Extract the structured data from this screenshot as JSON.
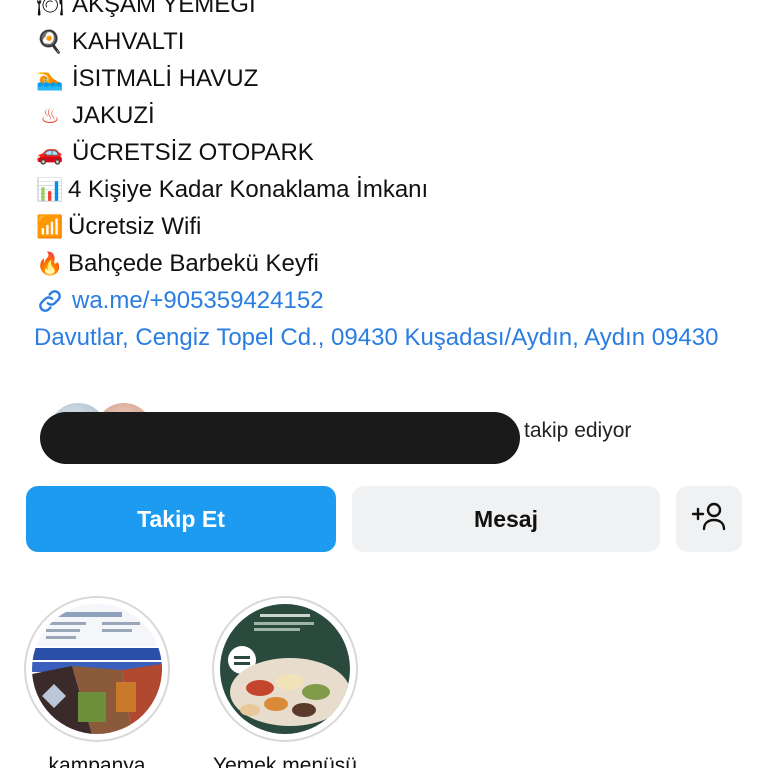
{
  "bio": {
    "lines": [
      {
        "icon": "plate-icon",
        "glyph": "🍽",
        "text": "AKŞAM YEMEĞİ"
      },
      {
        "icon": "frying-pan-icon",
        "glyph": "🍳",
        "text": "KAHVALTI"
      },
      {
        "icon": "swimmer-icon",
        "glyph": "🏊",
        "text": "İSITMALİ HAVUZ"
      },
      {
        "icon": "hot-springs-icon",
        "glyph": "♨",
        "text": "JAKUZİ"
      },
      {
        "icon": "car-icon",
        "glyph": "🚗",
        "text": "ÜCRETSİZ OTOPARK"
      },
      {
        "icon": "bar-chart-icon",
        "glyph": "📊",
        "text": "4 Kişiye Kadar Konaklama İmkanı"
      },
      {
        "icon": "signal-icon",
        "glyph": "📶",
        "text": "Ücretsiz Wifi"
      },
      {
        "icon": "fire-icon",
        "glyph": "🔥",
        "text": "Bahçede Barbekü Keyfi"
      }
    ],
    "link": "wa.me/+905359424152",
    "address": "Davutlar, Cengiz Topel Cd., 09430 Kuşadası/Aydın, Aydın 09430"
  },
  "followers": {
    "text": "takip ediyor"
  },
  "actions": {
    "follow_label": "Takip Et",
    "message_label": "Mesaj",
    "add_icon": "add-person-icon"
  },
  "highlights": [
    {
      "label": "kampanya"
    },
    {
      "label": "Yemek menüsü"
    }
  ],
  "colors": {
    "link": "#2a7de1",
    "primary_button": "#1d9bf0",
    "secondary_button": "#eff1f3"
  }
}
